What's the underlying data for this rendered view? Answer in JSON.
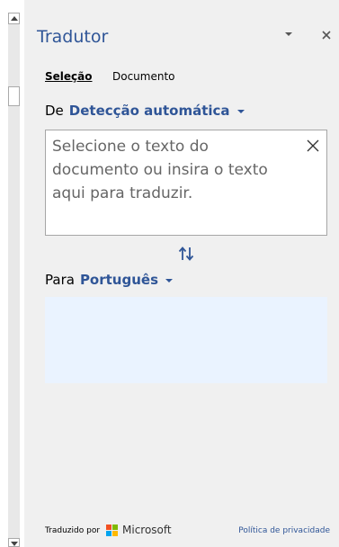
{
  "pane": {
    "title": "Tradutor"
  },
  "tabs": [
    {
      "label": "Seleção",
      "active": true
    },
    {
      "label": "Documento",
      "active": false
    }
  ],
  "from": {
    "label": "De",
    "language": "Detecção automática"
  },
  "source": {
    "placeholder": "Selecione o texto do documento ou insira o texto aqui para traduzir."
  },
  "to": {
    "label": "Para",
    "language": "Português"
  },
  "footer": {
    "translated_by": "Traduzido por",
    "brand": "Microsoft",
    "privacy": "Política de privacidade"
  },
  "colors": {
    "accent": "#2f5597",
    "pane_bg": "#f0f0f0",
    "target_bg": "#eaf3ff"
  },
  "icons": {
    "options": "chevron-down-icon",
    "close": "close-icon",
    "clear": "clear-icon",
    "swap": "swap-icon",
    "brand": "microsoft-logo"
  }
}
